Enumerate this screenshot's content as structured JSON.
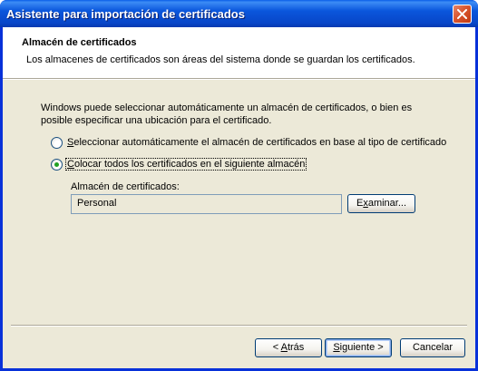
{
  "window": {
    "title": "Asistente para importación de certificados"
  },
  "header": {
    "title": "Almacén de certificados",
    "subtitle": "Los almacenes de certificados son áreas del sistema donde se guardan los certificados."
  },
  "body": {
    "description": "Windows puede seleccionar automáticamente un almacén de certificados, o bien es posible especificar una ubicación para el certificado.",
    "options": [
      {
        "hotkey": "S",
        "rest": "eleccionar automáticamente el almacén de certificados en base al tipo de certificado",
        "selected": false
      },
      {
        "hotkey": "C",
        "rest": "olocar todos los certificados en el siguiente almacén",
        "selected": true
      }
    ],
    "store_label": "Almacén de certificados:",
    "store_value": "Personal",
    "browse_button": {
      "pre": "E",
      "hotkey": "x",
      "post": "aminar..."
    }
  },
  "footer": {
    "back_button": {
      "pre": "< ",
      "hotkey": "A",
      "post": "trás"
    },
    "next_button": {
      "pre": "",
      "hotkey": "S",
      "post": "iguiente >"
    },
    "cancel_button": "Cancelar"
  },
  "colors": {
    "titlebar": "#0a56dc",
    "client_bg": "#ece9d8",
    "radio_selected": "#21a121"
  }
}
